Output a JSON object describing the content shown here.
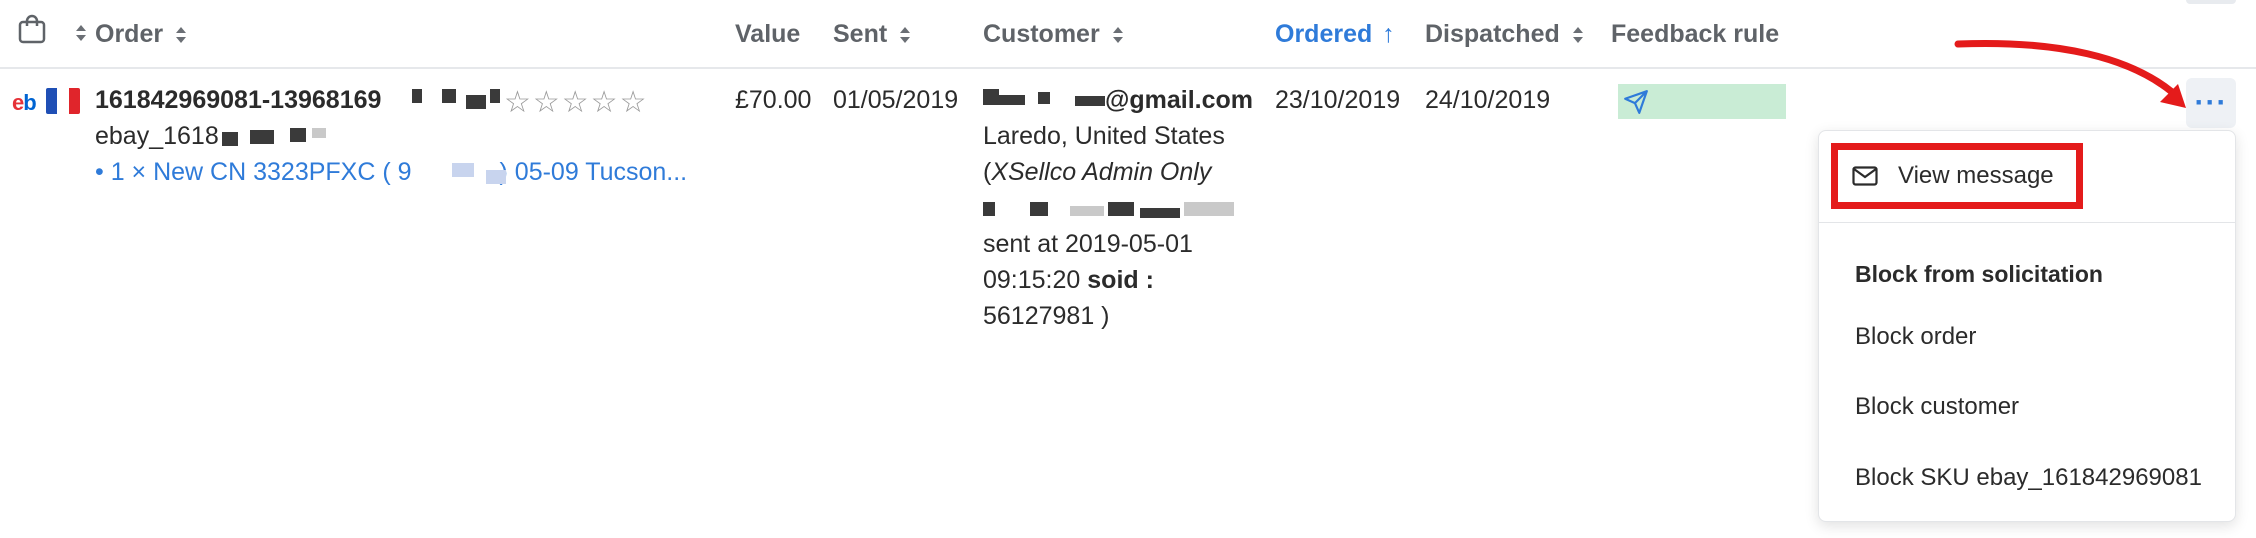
{
  "header": {
    "icons": {
      "bag": "shopping-bag-icon",
      "sort": "sort-icon"
    },
    "columns": {
      "order": "Order",
      "value": "Value",
      "sent": "Sent",
      "customer": "Customer",
      "ordered": "Ordered",
      "ordered_sort": "↑",
      "dispatched": "Dispatched",
      "feedback_rule": "Feedback rule"
    }
  },
  "row": {
    "marketplace_logo": "eb",
    "flag": "France",
    "order_id": "161842969081-13968169",
    "rating_stars": "☆☆☆☆☆",
    "sku": "ebay_1618",
    "item_link": "• 1 × New CN 3323PFXC ( 9",
    "item_link_suffix": ") 05-09 Tucson...",
    "value": "£70.00",
    "sent": "01/05/2019",
    "customer_email_domain": "@gmail.com",
    "customer_location": "Laredo, United States",
    "admin_note_open": "(",
    "admin_note_label": "XSellco Admin Only",
    "sent_at_line1": "sent at 2019-05-01",
    "sent_at_line2_time": "09:15:20 ",
    "soid_label": "soid :",
    "soid_value": "56127981 )",
    "ordered": "23/10/2019",
    "dispatched": "24/10/2019",
    "feedback_icon": "paper-plane-icon",
    "more_label": "···"
  },
  "menu": {
    "view_message": "View message",
    "block_section": "Block from solicitation",
    "block_order": "Block order",
    "block_customer": "Block customer",
    "block_sku": "Block SKU ebay_161842969081"
  },
  "colors": {
    "accent": "#2f7bd9",
    "annotation_red": "#e41b1b",
    "feedback_green": "#c9ecd5"
  }
}
